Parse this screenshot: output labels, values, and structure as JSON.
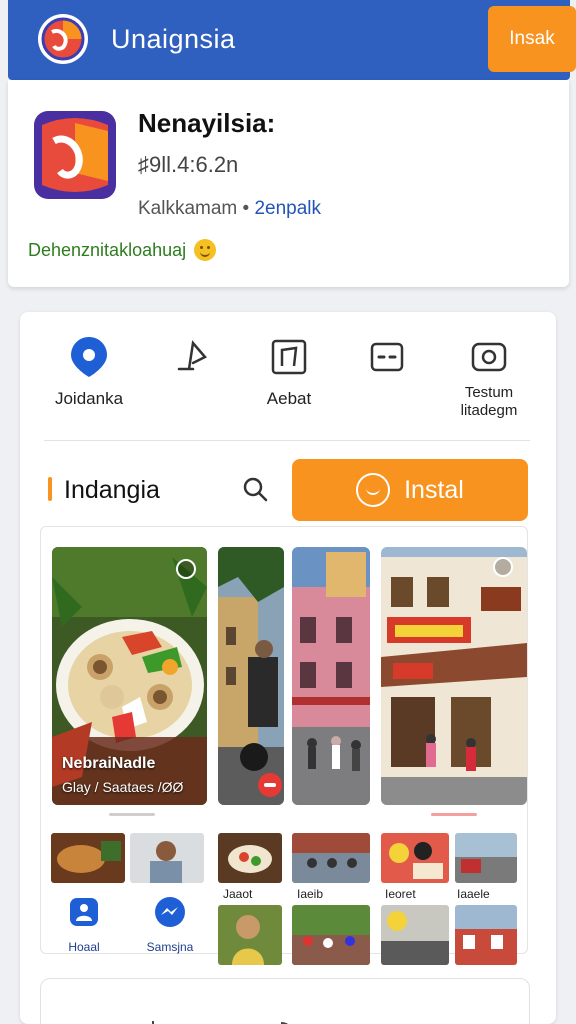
{
  "header": {
    "title": "Unaignsia",
    "install_label": "Insak",
    "brand_color": "#2f5fbf",
    "accent_color": "#f7931e"
  },
  "app": {
    "name": "Nenayilsia:",
    "version": "♯9ll.4:6.2n",
    "developer": "Kalkkamam",
    "separator": "•",
    "category": "2enpalk",
    "tagline": "Dehenznitakloahuaj",
    "tagline_icon": "smiley-icon"
  },
  "quick_actions": [
    {
      "label": "Joidanka",
      "icon": "location-pin-icon"
    },
    {
      "label": "",
      "icon": "music-note-icon"
    },
    {
      "label": "Aebat",
      "icon": "square-frame-icon"
    },
    {
      "label": "",
      "icon": "dialog-icon"
    },
    {
      "label": "Testum\nlitadegm",
      "icon": "camera-icon"
    }
  ],
  "section": {
    "title": "Indangia",
    "search_icon": "search-icon",
    "install_label": "Instal"
  },
  "gallery": {
    "main_caption": "NebraiNadle",
    "main_subcaption": "Glay / Saataes /ØØ"
  },
  "thumbnails": {
    "labels": [
      "Jaaot",
      "Iaeib",
      "Ieoret",
      "Iaaele"
    ],
    "tabs": [
      {
        "label": "Hoaal",
        "icon": "home-icon"
      },
      {
        "label": "Samsjna",
        "icon": "messenger-icon"
      }
    ]
  }
}
